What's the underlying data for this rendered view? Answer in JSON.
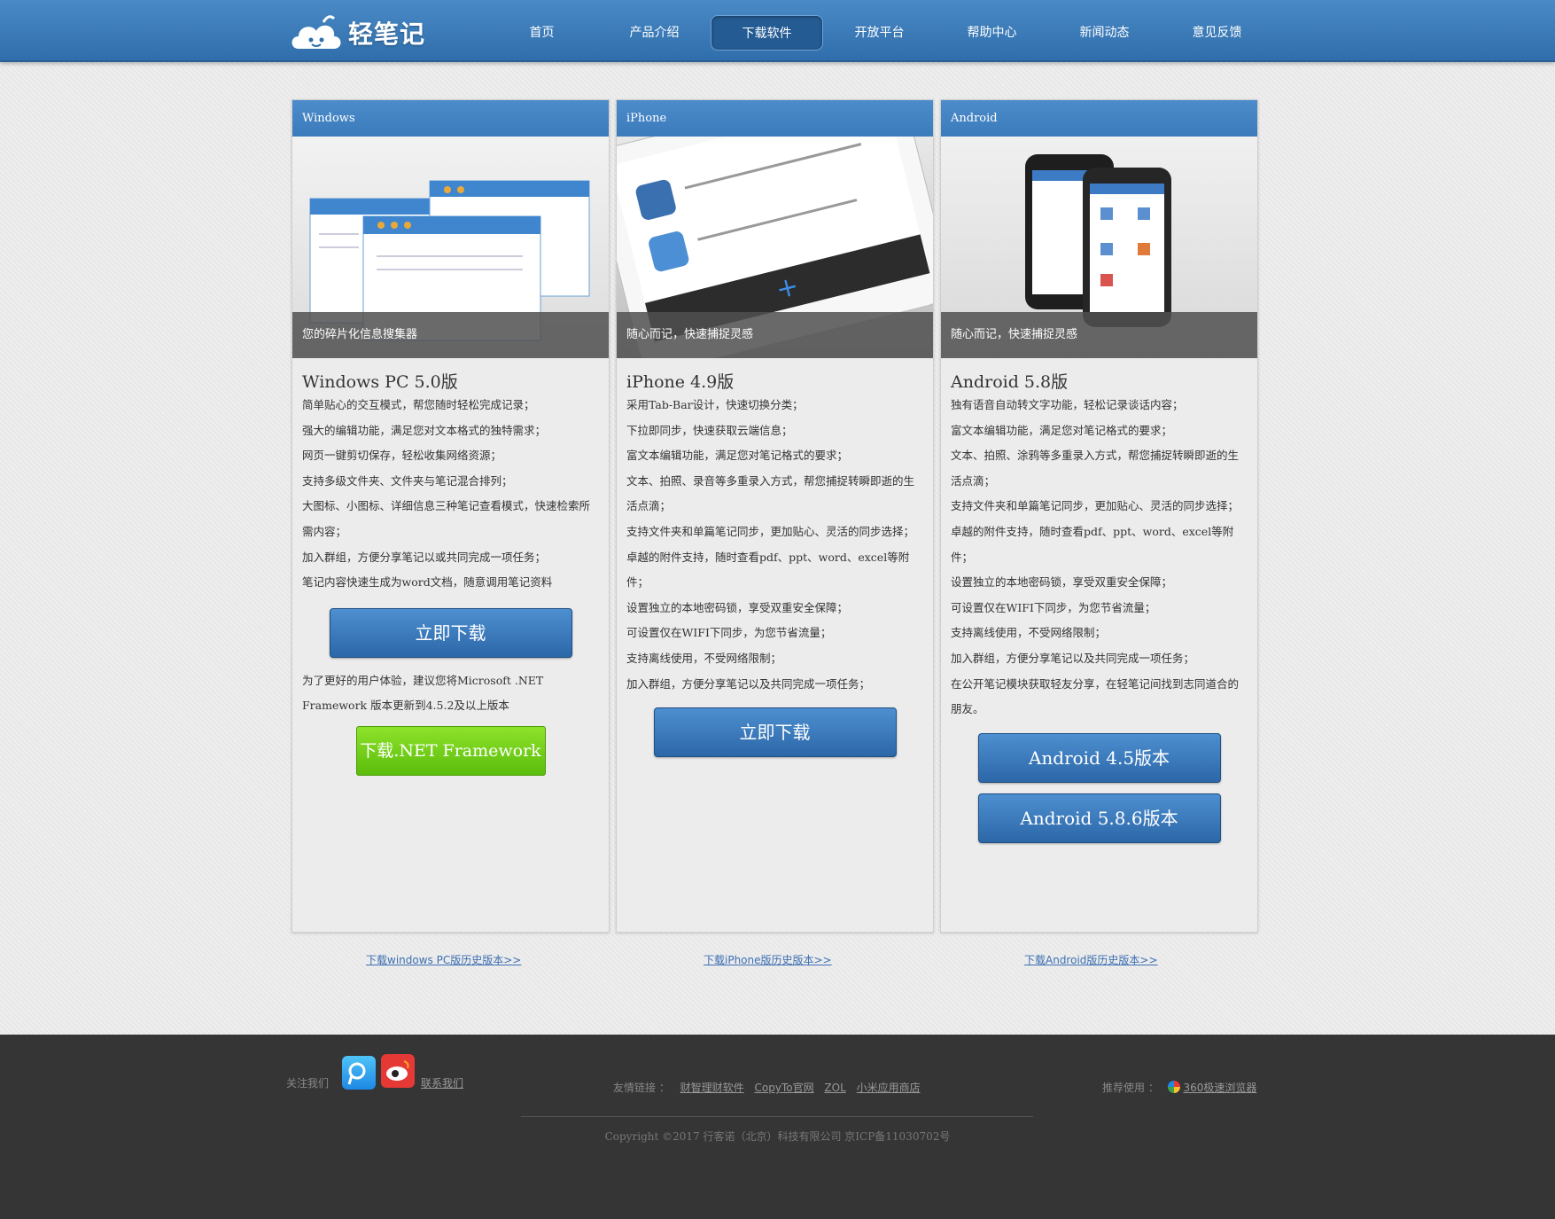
{
  "header": {
    "logo_text": "轻笔记",
    "nav": [
      "首页",
      "产品介绍",
      "下载软件",
      "开放平台",
      "帮助中心",
      "新闻动态",
      "意见反馈"
    ],
    "active_index": 2
  },
  "windows": {
    "tab": "Windows",
    "caption": "您的碎片化信息搜集器",
    "title": "Windows PC 5.0版",
    "features": [
      "简单贴心的交互模式，帮您随时轻松完成记录；",
      "强大的编辑功能，满足您对文本格式的独特需求；",
      "网页一键剪切保存，轻松收集网络资源；",
      "支持多级文件夹、文件夹与笔记混合排列；",
      "大图标、小图标、详细信息三种笔记查看模式，快速检索所需内容；",
      "加入群组，方便分享笔记以或共同完成一项任务；",
      "笔记内容快速生成为word文档，随意调用笔记资料"
    ],
    "download": "立即下载",
    "note": "为了更好的用户体验，建议您将Microsoft .NET Framework 版本更新到4.5.2及以上版本",
    "net_button": "下载.NET Framework",
    "history_link": "下载windows PC版历史版本>>"
  },
  "iphone": {
    "tab": "iPhone",
    "caption": "随心而记，快速捕捉灵感",
    "title": "iPhone 4.9版",
    "features": [
      "采用Tab-Bar设计，快速切换分类；",
      "下拉即同步，快速获取云端信息；",
      "富文本编辑功能，满足您对笔记格式的要求；",
      "文本、拍照、录音等多重录入方式，帮您捕捉转瞬即逝的生活点滴；",
      "支持文件夹和单篇笔记同步，更加贴心、灵活的同步选择；",
      "卓越的附件支持，随时查看pdf、ppt、word、excel等附件；",
      "设置独立的本地密码锁，享受双重安全保障；",
      "可设置仅在WIFI下同步，为您节省流量；",
      "支持离线使用，不受网络限制；",
      "加入群组，方便分享笔记以及共同完成一项任务；"
    ],
    "download": "立即下载",
    "history_link": "下载iPhone版历史版本>>"
  },
  "android": {
    "tab": "Android",
    "caption": "随心而记，快速捕捉灵感",
    "title": "Android 5.8版",
    "features": [
      "独有语音自动转文字功能，轻松记录谈话内容；",
      "富文本编辑功能，满足您对笔记格式的要求；",
      "文本、拍照、涂鸦等多重录入方式，帮您捕捉转瞬即逝的生活点滴；",
      "支持文件夹和单篇笔记同步，更加贴心、灵活的同步选择；",
      "卓越的附件支持，随时查看pdf、ppt、word、excel等附件；",
      "设置独立的本地密码锁，享受双重安全保障；",
      "可设置仅在WIFI下同步，为您节省流量；",
      "支持离线使用，不受网络限制；",
      "加入群组，方便分享笔记以及共同完成一项任务；",
      "在公开笔记模块获取轻友分享，在轻笔记间找到志同道合的朋友。"
    ],
    "btn_old": "Android 4.5版本",
    "btn_new": "Android 5.8.6版本",
    "history_link": "下载Android版历史版本>>"
  },
  "footer": {
    "follow": "关注我们",
    "contact": "联系我们",
    "friends_label": "友情链接 ：",
    "friends": [
      "财智理财软件",
      "CopyTo官网",
      "ZOL",
      "小米应用商店"
    ],
    "recommend_label": "推荐使用 ：",
    "browser": "360极速浏览器",
    "copyright": "Copyright ©2017 行客诺（北京）科技有限公司 京ICP备11030702号"
  }
}
